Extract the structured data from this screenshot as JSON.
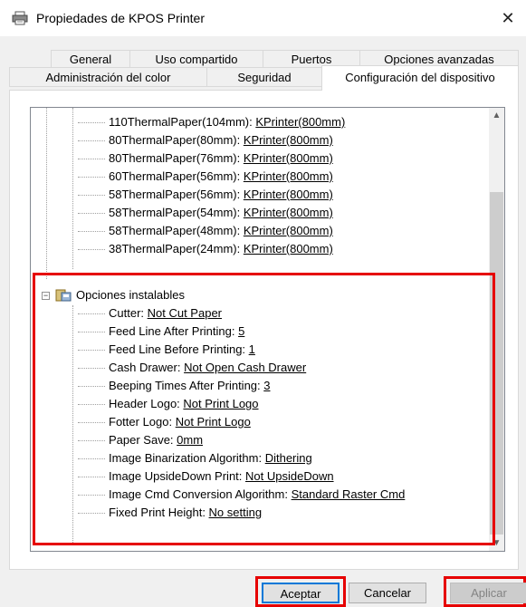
{
  "window": {
    "title": "Propiedades de KPOS Printer",
    "close_glyph": "✕",
    "icon": "printer-icon"
  },
  "tabs_row1": [
    {
      "label": "General"
    },
    {
      "label": "Uso compartido"
    },
    {
      "label": "Puertos"
    },
    {
      "label": "Opciones avanzadas"
    }
  ],
  "tabs_row2": [
    {
      "label": "Administración del color"
    },
    {
      "label": "Seguridad"
    },
    {
      "label": "Configuración del dispositivo",
      "active": true
    }
  ],
  "tree": {
    "paper_items": [
      {
        "label": "110ThermalPaper(104mm): ",
        "value": "KPrinter(800mm)"
      },
      {
        "label": "80ThermalPaper(80mm): ",
        "value": "KPrinter(800mm)"
      },
      {
        "label": "80ThermalPaper(76mm): ",
        "value": "KPrinter(800mm)"
      },
      {
        "label": "60ThermalPaper(56mm): ",
        "value": "KPrinter(800mm)"
      },
      {
        "label": "58ThermalPaper(56mm): ",
        "value": "KPrinter(800mm)"
      },
      {
        "label": "58ThermalPaper(54mm): ",
        "value": "KPrinter(800mm)"
      },
      {
        "label": "58ThermalPaper(48mm): ",
        "value": "KPrinter(800mm)"
      },
      {
        "label": "38ThermalPaper(24mm): ",
        "value": "KPrinter(800mm)"
      }
    ],
    "group_label": "Opciones instalables",
    "group_expander": "−",
    "options": [
      {
        "label": "Cutter: ",
        "value": "Not Cut Paper"
      },
      {
        "label": "Feed Line After Printing: ",
        "value": "5"
      },
      {
        "label": "Feed Line Before Printing: ",
        "value": "1"
      },
      {
        "label": "Cash Drawer: ",
        "value": "Not Open Cash Drawer"
      },
      {
        "label": "Beeping Times After Printing: ",
        "value": "3"
      },
      {
        "label": "Header Logo: ",
        "value": "Not Print Logo"
      },
      {
        "label": "Fotter Logo: ",
        "value": "Not Print Logo"
      },
      {
        "label": "Paper Save: ",
        "value": "0mm"
      },
      {
        "label": "Image Binarization Algorithm: ",
        "value": "Dithering"
      },
      {
        "label": "Image UpsideDown Print: ",
        "value": "Not UpsideDown"
      },
      {
        "label": "Image Cmd Conversion Algorithm: ",
        "value": "Standard Raster Cmd"
      },
      {
        "label": "Fixed Print Height: ",
        "value": "No setting"
      }
    ]
  },
  "scrollbar": {
    "up_glyph": "▲",
    "down_glyph": "▼"
  },
  "buttons": {
    "ok": "Aceptar",
    "cancel": "Cancelar",
    "apply": "Aplicar"
  },
  "colors": {
    "highlight": "#e60000",
    "focus": "#0078d7"
  }
}
